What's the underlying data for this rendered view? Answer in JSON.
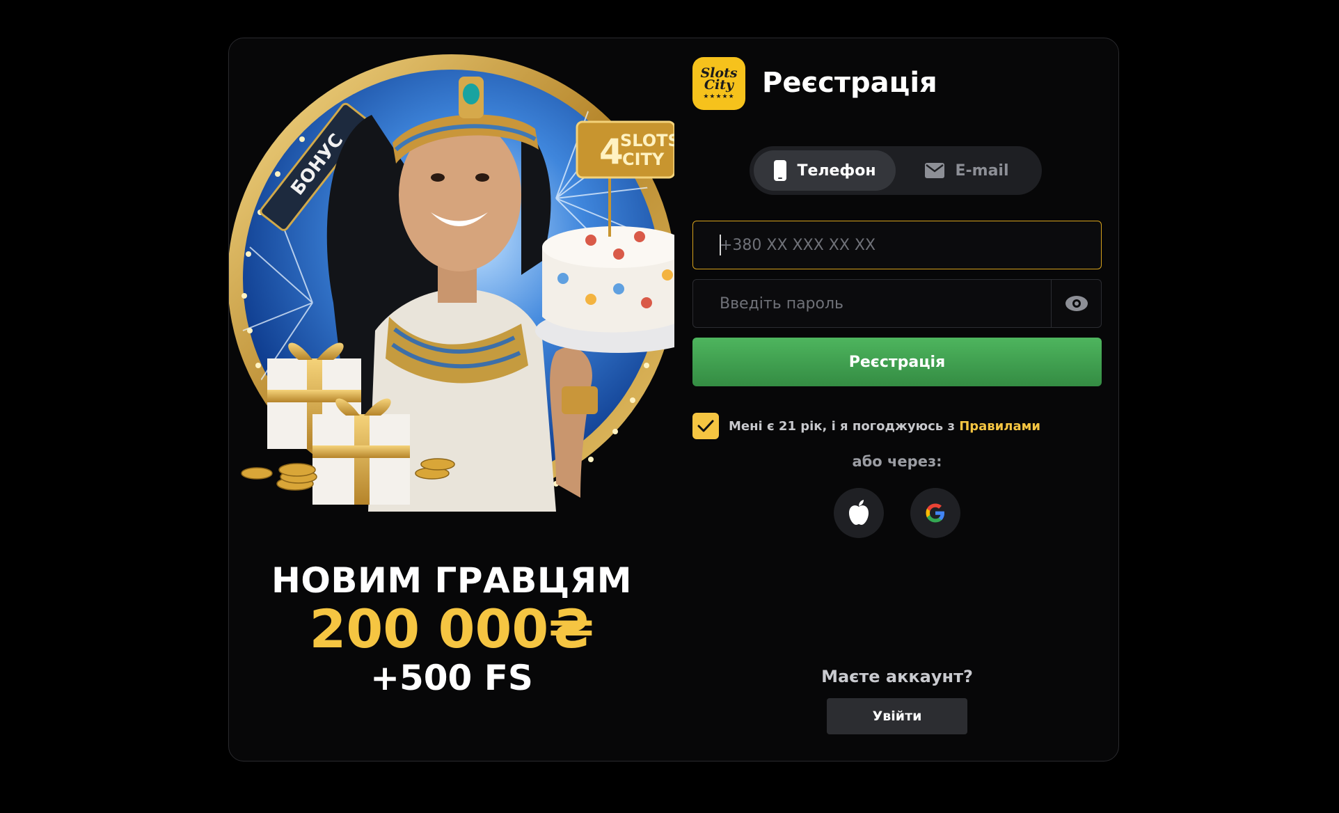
{
  "header": {
    "logo_text_line1": "Slots",
    "logo_text_line2": "City",
    "logo_stars": "★★★★★",
    "title": "Реєстрація",
    "close_icon": "close-icon"
  },
  "promo": {
    "badge_label": "БОНУС",
    "sign_number": "4",
    "sign_text_line1": "SLOTS",
    "sign_text_line2": "CITY",
    "line1": "НОВИМ ГРАВЦЯМ",
    "line2": "200 000₴",
    "line3": "+500 FS"
  },
  "tabs": [
    {
      "label": "Телефон",
      "icon": "phone-icon",
      "active": true
    },
    {
      "label": "E-mail",
      "icon": "mail-icon",
      "active": false
    }
  ],
  "fields": {
    "phone_placeholder": "+380 XX XXX XX XX",
    "phone_value": "",
    "password_placeholder": "Введіть пароль",
    "password_value": ""
  },
  "register_button": "Реєстрація",
  "agreement": {
    "checked": true,
    "text": "Мені є 21 рік, і я погоджуюсь з ",
    "link": "Правилами"
  },
  "or_text": "або через:",
  "socials": [
    "apple-icon",
    "google-icon"
  ],
  "account": {
    "question": "Маєте аккаунт?",
    "login_button": "Увійти"
  },
  "colors": {
    "accent": "#f5c542",
    "register": "#43a853",
    "background": "#000000"
  }
}
